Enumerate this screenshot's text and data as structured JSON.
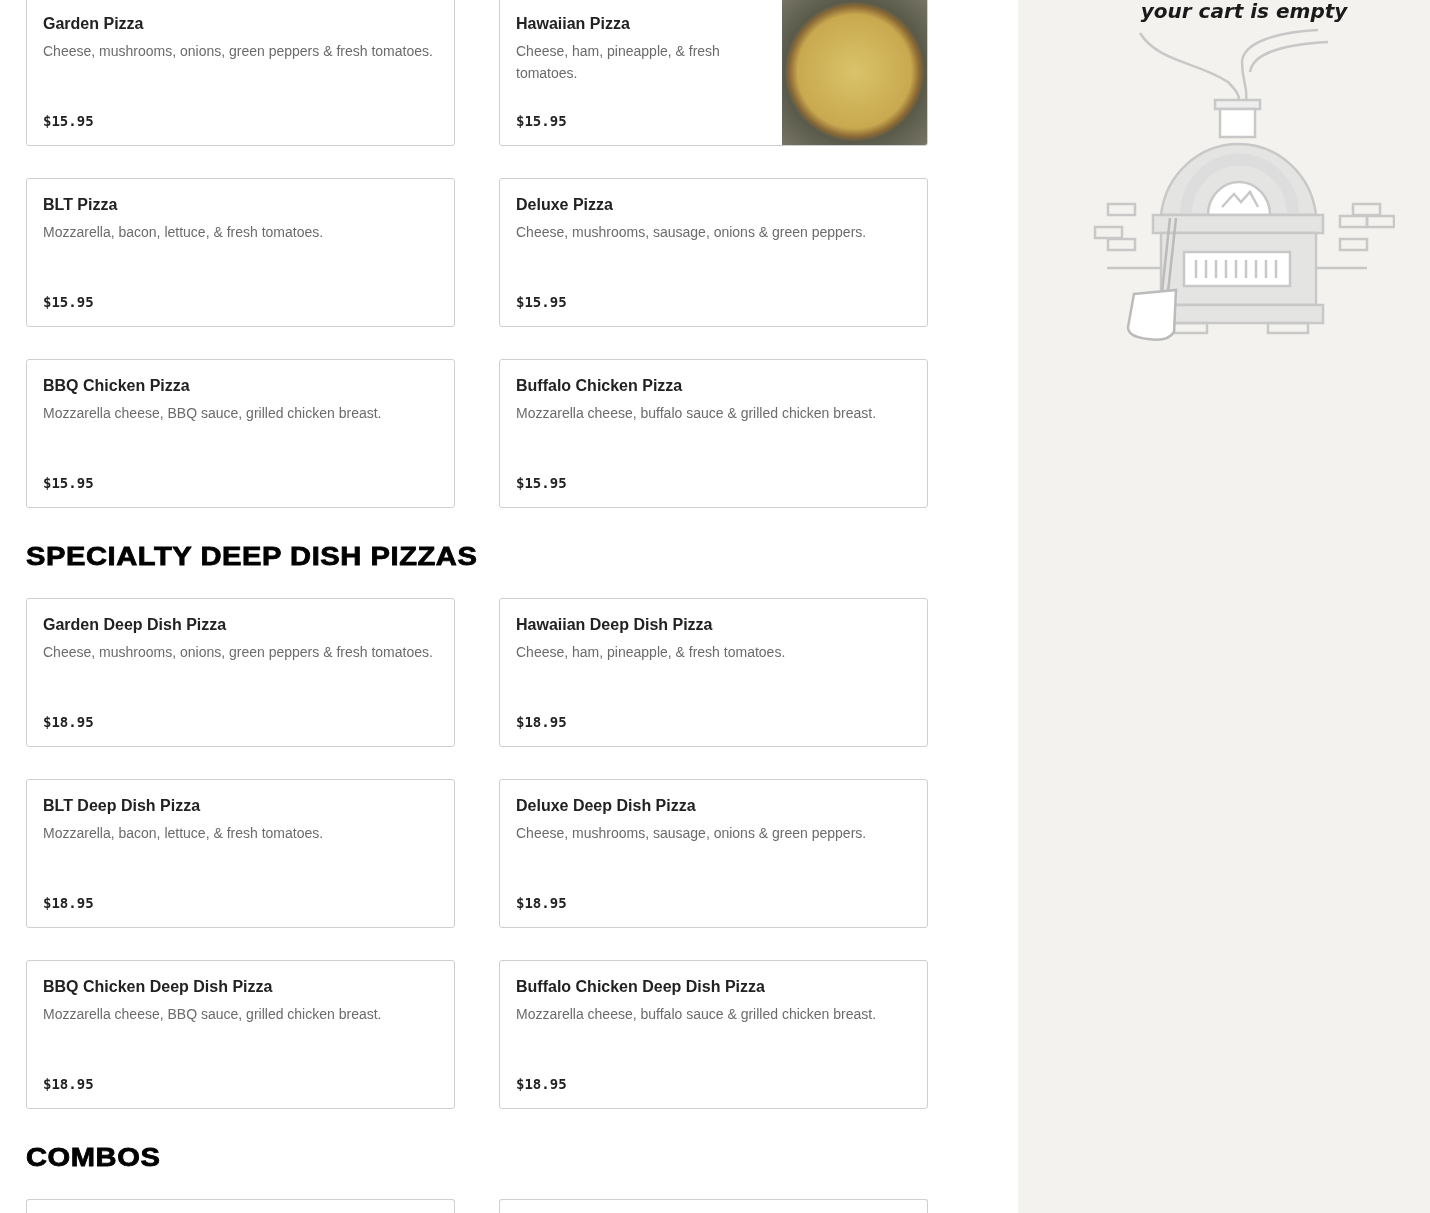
{
  "sections": [
    {
      "items": [
        {
          "kind": "item",
          "name": "Garden Pizza",
          "description": "Cheese, mushrooms, onions, green peppers & fresh tomatoes.",
          "price": "$15.95",
          "photo": false
        },
        {
          "kind": "item",
          "name": "Hawaiian Pizza",
          "description": "Cheese, ham, pineapple, & fresh tomatoes.",
          "price": "$15.95",
          "photo": true
        },
        {
          "kind": "item",
          "name": "BLT Pizza",
          "description": "Mozzarella, bacon, lettuce, & fresh tomatoes.",
          "price": "$15.95",
          "photo": false
        },
        {
          "kind": "item",
          "name": "Deluxe Pizza",
          "description": "Cheese, mushrooms, sausage, onions & green peppers.",
          "price": "$15.95",
          "photo": false
        },
        {
          "kind": "item",
          "name": "BBQ Chicken Pizza",
          "description": "Mozzarella cheese, BBQ sauce, grilled chicken breast.",
          "price": "$15.95",
          "photo": false
        },
        {
          "kind": "item",
          "name": "Buffalo Chicken Pizza",
          "description": "Mozzarella cheese, buffalo sauce & grilled chicken breast.",
          "price": "$15.95",
          "photo": false
        }
      ]
    },
    {
      "heading": "SPECIALTY DEEP DISH PIZZAS",
      "items": [
        {
          "kind": "item",
          "name": "Garden Deep Dish Pizza",
          "description": "Cheese, mushrooms, onions, green peppers & fresh tomatoes.",
          "price": "$18.95",
          "photo": false
        },
        {
          "kind": "item",
          "name": "Hawaiian Deep Dish Pizza",
          "description": "Cheese, ham, pineapple, & fresh tomatoes.",
          "price": "$18.95",
          "photo": false
        },
        {
          "kind": "item",
          "name": "BLT Deep Dish Pizza",
          "description": "Mozzarella, bacon, lettuce, & fresh tomatoes.",
          "price": "$18.95",
          "photo": false
        },
        {
          "kind": "item",
          "name": "Deluxe Deep Dish Pizza",
          "description": "Cheese, mushrooms, sausage, onions & green peppers.",
          "price": "$18.95",
          "photo": false
        },
        {
          "kind": "item",
          "name": "BBQ Chicken Deep Dish Pizza",
          "description": "Mozzarella cheese, BBQ sauce, grilled chicken breast.",
          "price": "$18.95",
          "photo": false
        },
        {
          "kind": "item",
          "name": "Buffalo Chicken Deep Dish Pizza",
          "description": "Mozzarella cheese, buffalo sauce & grilled chicken breast.",
          "price": "$18.95",
          "photo": false
        }
      ]
    },
    {
      "heading": "COMBOS",
      "items": [
        {
          "kind": "cut-off"
        },
        {
          "kind": "cut-off"
        }
      ]
    }
  ],
  "cart": {
    "message": "your cart is empty"
  }
}
